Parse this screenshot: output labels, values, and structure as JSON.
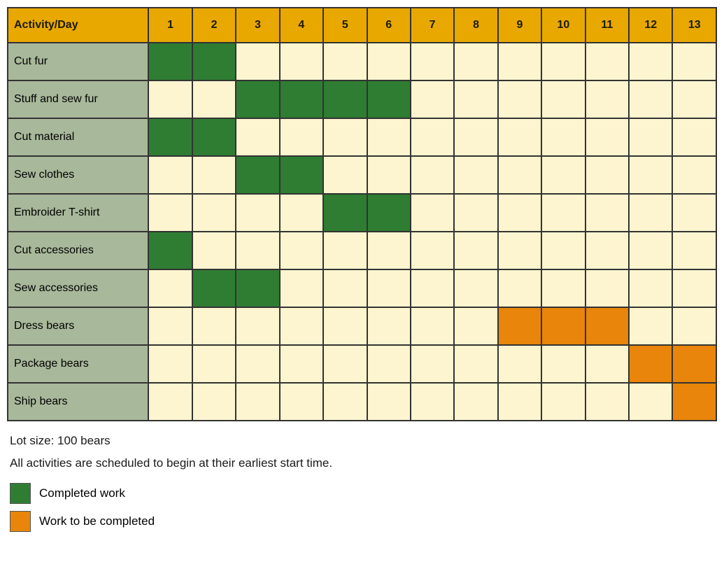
{
  "header": {
    "activity_day_label": "Activity/Day",
    "days": [
      "1",
      "2",
      "3",
      "4",
      "5",
      "6",
      "7",
      "8",
      "9",
      "10",
      "11",
      "12",
      "13"
    ]
  },
  "activities": [
    {
      "name": "Cut fur",
      "cells": [
        "green",
        "green",
        "empty",
        "empty",
        "empty",
        "empty",
        "empty",
        "empty",
        "empty",
        "empty",
        "empty",
        "empty",
        "empty"
      ]
    },
    {
      "name": "Stuff and sew fur",
      "cells": [
        "empty",
        "empty",
        "green",
        "green",
        "green",
        "green",
        "empty",
        "empty",
        "empty",
        "empty",
        "empty",
        "empty",
        "empty"
      ]
    },
    {
      "name": "Cut material",
      "cells": [
        "green",
        "green",
        "empty",
        "empty",
        "empty",
        "empty",
        "empty",
        "empty",
        "empty",
        "empty",
        "empty",
        "empty",
        "empty"
      ]
    },
    {
      "name": "Sew clothes",
      "cells": [
        "empty",
        "empty",
        "green",
        "green",
        "empty",
        "empty",
        "empty",
        "empty",
        "empty",
        "empty",
        "empty",
        "empty",
        "empty"
      ]
    },
    {
      "name": "Embroider T-shirt",
      "cells": [
        "empty",
        "empty",
        "empty",
        "empty",
        "green",
        "green",
        "empty",
        "empty",
        "empty",
        "empty",
        "empty",
        "empty",
        "empty"
      ]
    },
    {
      "name": "Cut accessories",
      "cells": [
        "green",
        "empty",
        "empty",
        "empty",
        "empty",
        "empty",
        "empty",
        "empty",
        "empty",
        "empty",
        "empty",
        "empty",
        "empty"
      ]
    },
    {
      "name": "Sew accessories",
      "cells": [
        "empty",
        "green",
        "green",
        "empty",
        "empty",
        "empty",
        "empty",
        "empty",
        "empty",
        "empty",
        "empty",
        "empty",
        "empty"
      ]
    },
    {
      "name": "Dress bears",
      "cells": [
        "empty",
        "empty",
        "empty",
        "empty",
        "empty",
        "empty",
        "empty",
        "empty",
        "orange",
        "orange",
        "orange",
        "empty",
        "empty"
      ]
    },
    {
      "name": "Package bears",
      "cells": [
        "empty",
        "empty",
        "empty",
        "empty",
        "empty",
        "empty",
        "empty",
        "empty",
        "empty",
        "empty",
        "empty",
        "orange",
        "orange"
      ]
    },
    {
      "name": "Ship bears",
      "cells": [
        "empty",
        "empty",
        "empty",
        "empty",
        "empty",
        "empty",
        "empty",
        "empty",
        "empty",
        "empty",
        "empty",
        "empty",
        "orange"
      ]
    }
  ],
  "footnotes": {
    "lot_size": "Lot size: 100 bears",
    "schedule_note": "All activities are scheduled to begin at their earliest start time."
  },
  "legend": {
    "completed_work_label": "Completed work",
    "work_to_complete_label": "Work to be completed"
  }
}
